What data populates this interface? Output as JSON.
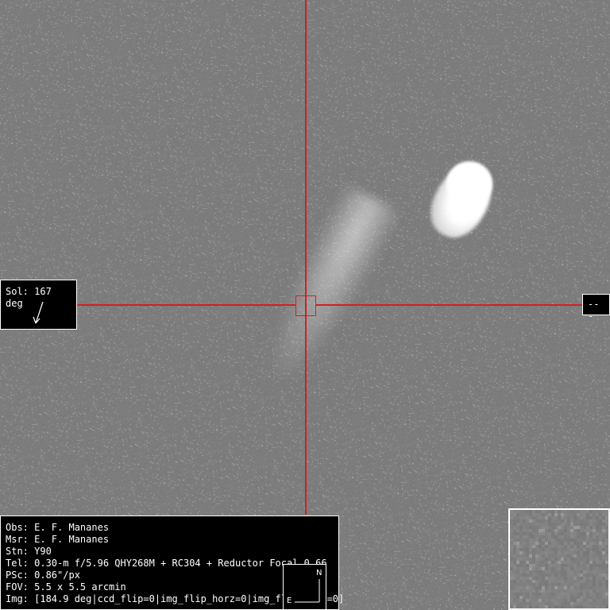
{
  "overlay": {
    "sol_label": "Sol: 167 deg",
    "right_label": "---",
    "compass_north": "N",
    "compass_east": "E"
  },
  "info": {
    "obs": "Obs: E. F. Mananes",
    "msr": "Msr: E. F. Mananes",
    "stn": "Stn: Y90",
    "tel": "Tel: 0.30-m f/5.96 QHY268M + RC304 + Reductor Focal 0.66",
    "psc": "PSc: 0.86\"/px",
    "fov": "FOV: 5.5 x 5.5 arcmin",
    "img": "Img: [184.9 deg|ccd_flip=0|img_flip_horz=0|img_flip_vert=0]"
  },
  "colors": {
    "crosshair": "#d02020",
    "background": "#7d7d7d",
    "panel": "#000000",
    "text": "#ffffff"
  },
  "icons": {
    "sun_direction": "arrow-icon",
    "compass": "compass-icon"
  }
}
